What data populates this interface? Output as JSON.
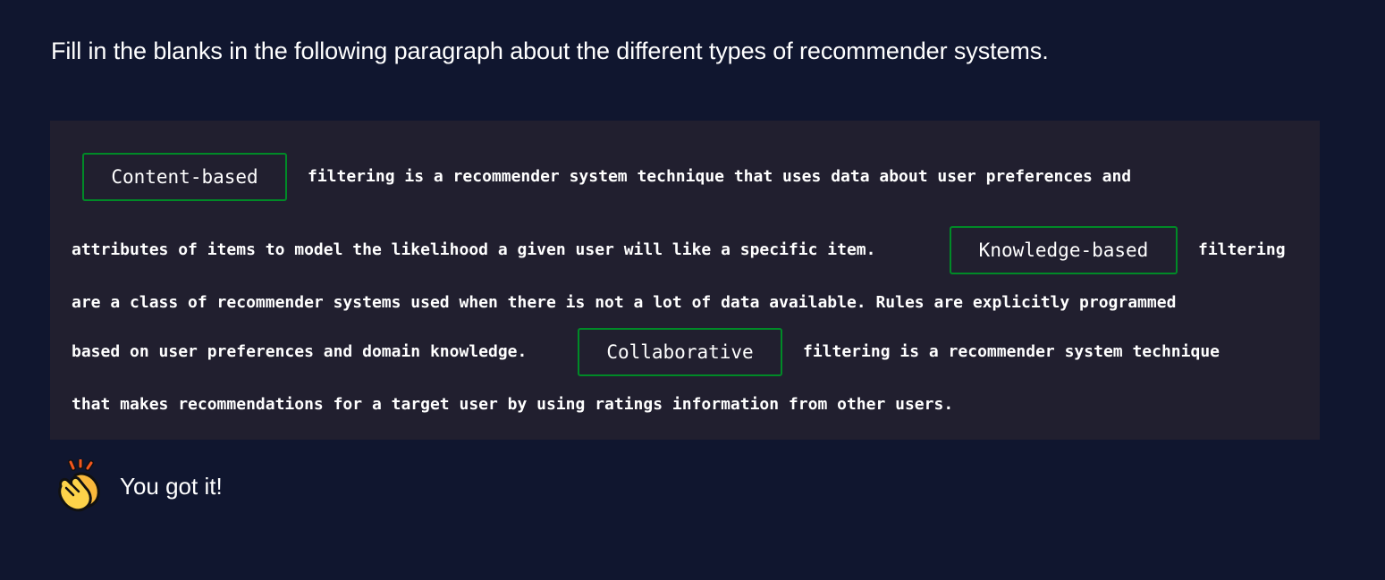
{
  "instructions": "Fill in the blanks in the following paragraph about the different types of recommender systems.",
  "paragraph": {
    "blank_1": "Content-based",
    "line_1": "filtering is a recommender system technique that uses data about user preferences and",
    "line_2": "attributes of items to model the likelihood a given user will like a specific item.",
    "blank_2": "Knowledge-based",
    "line_2_end": "filtering",
    "line_3": "are a class of recommender systems used when there is not a lot of data available. Rules are explicitly programmed",
    "line_4": "based on user preferences and domain knowledge.",
    "blank_3": "Collaborative",
    "line_4_end": "filtering is a recommender system technique",
    "line_5": "that makes recommendations for a target user by using ratings information from other users."
  },
  "feedback": {
    "icon": "clapping-hands-icon",
    "text": "You got it!"
  },
  "colors": {
    "background": "#10162f",
    "code_background": "#211f2f",
    "correct_border": "#008a27"
  }
}
